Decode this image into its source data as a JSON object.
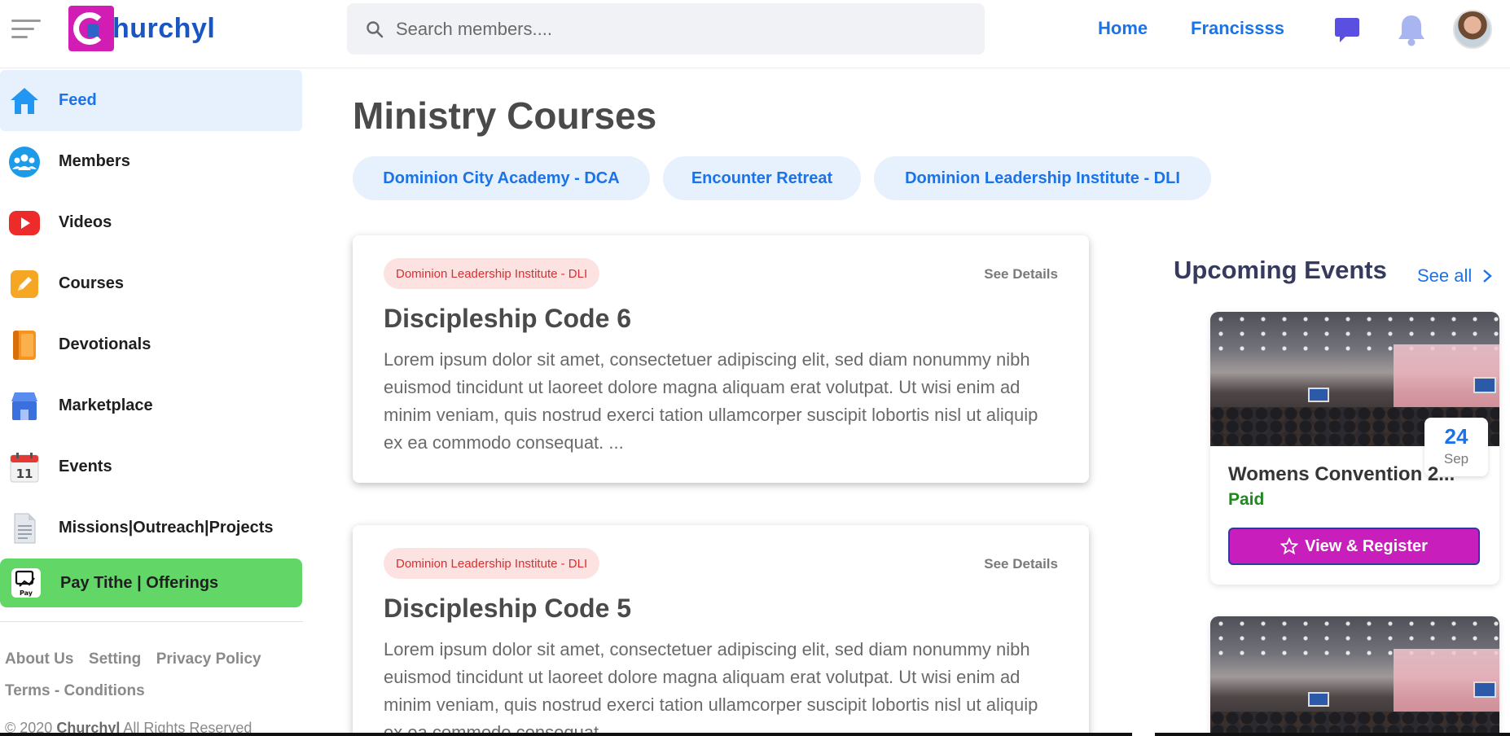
{
  "brand": {
    "logo_text": "hurchyl"
  },
  "header": {
    "search_placeholder": "Search members....",
    "nav": [
      "Home",
      "Francissss"
    ]
  },
  "sidebar": {
    "items": [
      {
        "label": "Feed",
        "icon": "home-icon"
      },
      {
        "label": "Members",
        "icon": "members-icon"
      },
      {
        "label": "Videos",
        "icon": "video-play-icon"
      },
      {
        "label": "Courses",
        "icon": "courses-pencil-icon"
      },
      {
        "label": "Devotionals",
        "icon": "book-icon"
      },
      {
        "label": "Marketplace",
        "icon": "store-icon"
      },
      {
        "label": "Events",
        "icon": "calendar-icon"
      },
      {
        "label": "Missions|Outreach|Projects",
        "icon": "document-icon"
      }
    ],
    "calendar_day": "11",
    "pay_icon_label": "Pay",
    "pay": {
      "label": "Pay Tithe | Offerings"
    },
    "footer_links": [
      "About Us",
      "Setting",
      "Privacy Policy",
      "Terms - Conditions"
    ],
    "copyright_prefix": "© 2020",
    "copyright_brand": "Churchyl",
    "copyright_suffix": "All Rights Reserved"
  },
  "main": {
    "title": "Ministry Courses",
    "chips": [
      "Dominion City Academy - DCA",
      "Encounter Retreat",
      "Dominion Leadership Institute - DLI"
    ],
    "courses": [
      {
        "tag": "Dominion Leadership Institute - DLI",
        "see_details": "See Details",
        "title": "Discipleship Code 6",
        "description": "Lorem ipsum dolor sit amet, consectetuer adipiscing elit, sed diam nonummy nibh euismod tincidunt ut laoreet dolore magna aliquam erat volutpat. Ut wisi enim ad minim veniam, quis nostrud exerci tation ullamcorper suscipit lobortis nisl ut aliquip ex ea commodo consequat. ..."
      },
      {
        "tag": "Dominion Leadership Institute - DLI",
        "see_details": "See Details",
        "title": "Discipleship Code 5",
        "description": "Lorem ipsum dolor sit amet, consectetuer adipiscing elit, sed diam nonummy nibh euismod tincidunt ut laoreet dolore magna aliquam erat volutpat. Ut wisi enim ad minim veniam, quis nostrud exerci tation ullamcorper suscipit lobortis nisl ut aliquip ex ea commodo consequat. ..."
      }
    ]
  },
  "events": {
    "title": "Upcoming Events",
    "see_all": "See all",
    "items": [
      {
        "day": "24",
        "month": "Sep",
        "name": "Womens Convention 2...",
        "price": "Paid",
        "button": "View & Register"
      }
    ]
  },
  "colors": {
    "accent": "#1a73e8",
    "pay_green": "#62d768",
    "register_magenta": "#c81ebc",
    "active_bg": "#e7f0fd",
    "tag_red": "#d63030"
  }
}
